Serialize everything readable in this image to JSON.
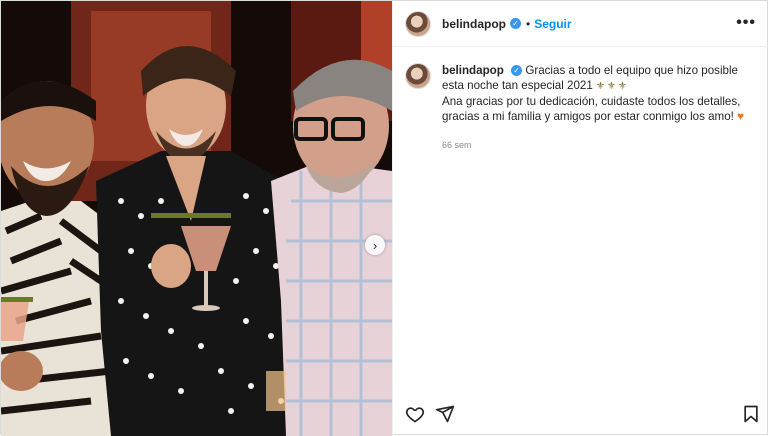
{
  "post": {
    "username": "belindapop",
    "follow_label": "Seguir",
    "more_label": "•••",
    "caption": {
      "line1": "Gracias a todo el equipo que hizo posible esta noche tan especial 2021",
      "line1_emoji": "⚜⚜⚜",
      "line2": "Ana gracias por tu dedicación, cuidaste todos los detalles, gracias a mi familia y amigos por estar conmigo los amo!",
      "line2_emoji": "♥"
    },
    "time": "66 sem",
    "next_label": "›"
  },
  "colors": {
    "link_blue": "#0095f6",
    "verified_blue": "#3897f0",
    "text": "#262626",
    "muted": "#8e8e8e"
  },
  "icons": [
    "heart-icon",
    "share-icon",
    "bookmark-icon",
    "verified-icon",
    "more-icon",
    "chevron-right-icon"
  ]
}
